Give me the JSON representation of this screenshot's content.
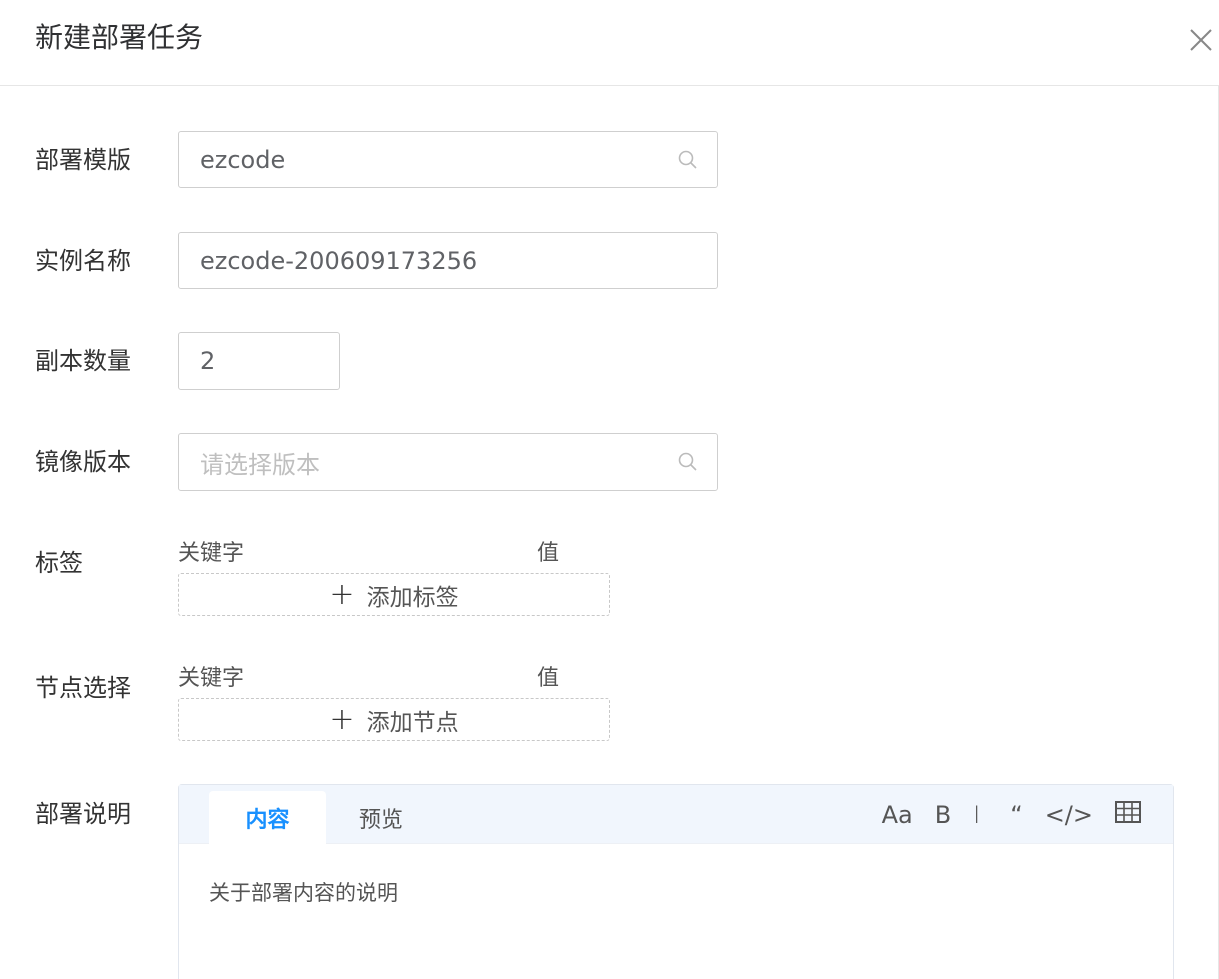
{
  "header": {
    "title": "新建部署任务"
  },
  "form": {
    "template": {
      "label": "部署模版",
      "value": "ezcode"
    },
    "instance_name": {
      "label": "实例名称",
      "value": "ezcode-200609173256"
    },
    "replicas": {
      "label": "副本数量",
      "value": "2"
    },
    "image_version": {
      "label": "镜像版本",
      "placeholder": "请选择版本"
    },
    "labels": {
      "label": "标签",
      "key_header": "关键字",
      "value_header": "值",
      "add_label": "添加标签"
    },
    "node_selector": {
      "label": "节点选择",
      "key_header": "关键字",
      "value_header": "值",
      "add_label": "添加节点"
    },
    "description": {
      "label": "部署说明",
      "tabs": [
        "内容",
        "预览"
      ],
      "toolbar": {
        "heading": "Aa",
        "bold": "B",
        "italic": "I",
        "quote": "“",
        "code": "</>",
        "table_icon": "table-icon"
      },
      "content": "关于部署内容的说明"
    }
  },
  "colors": {
    "accent": "#1890ff",
    "editor_bar": "#f1f6fd",
    "border": "#cfcfcf"
  }
}
